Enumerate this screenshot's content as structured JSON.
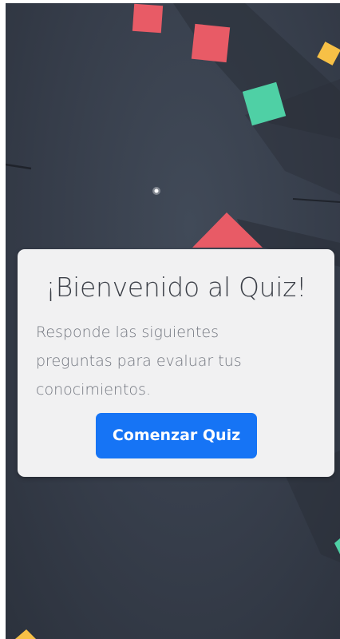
{
  "welcome": {
    "title": "¡Bienvenido al Quiz!",
    "description": "Responde las siguientes preguntas para evaluar tus conocimientos.",
    "start_button_label": "Comenzar Quiz"
  },
  "colors": {
    "background": "#363d4a",
    "card": "#f1f1f2",
    "button": "#1674f5",
    "confetti_red": "#e85b66",
    "confetti_green": "#4fd0a5",
    "confetti_yellow": "#f7c046"
  }
}
